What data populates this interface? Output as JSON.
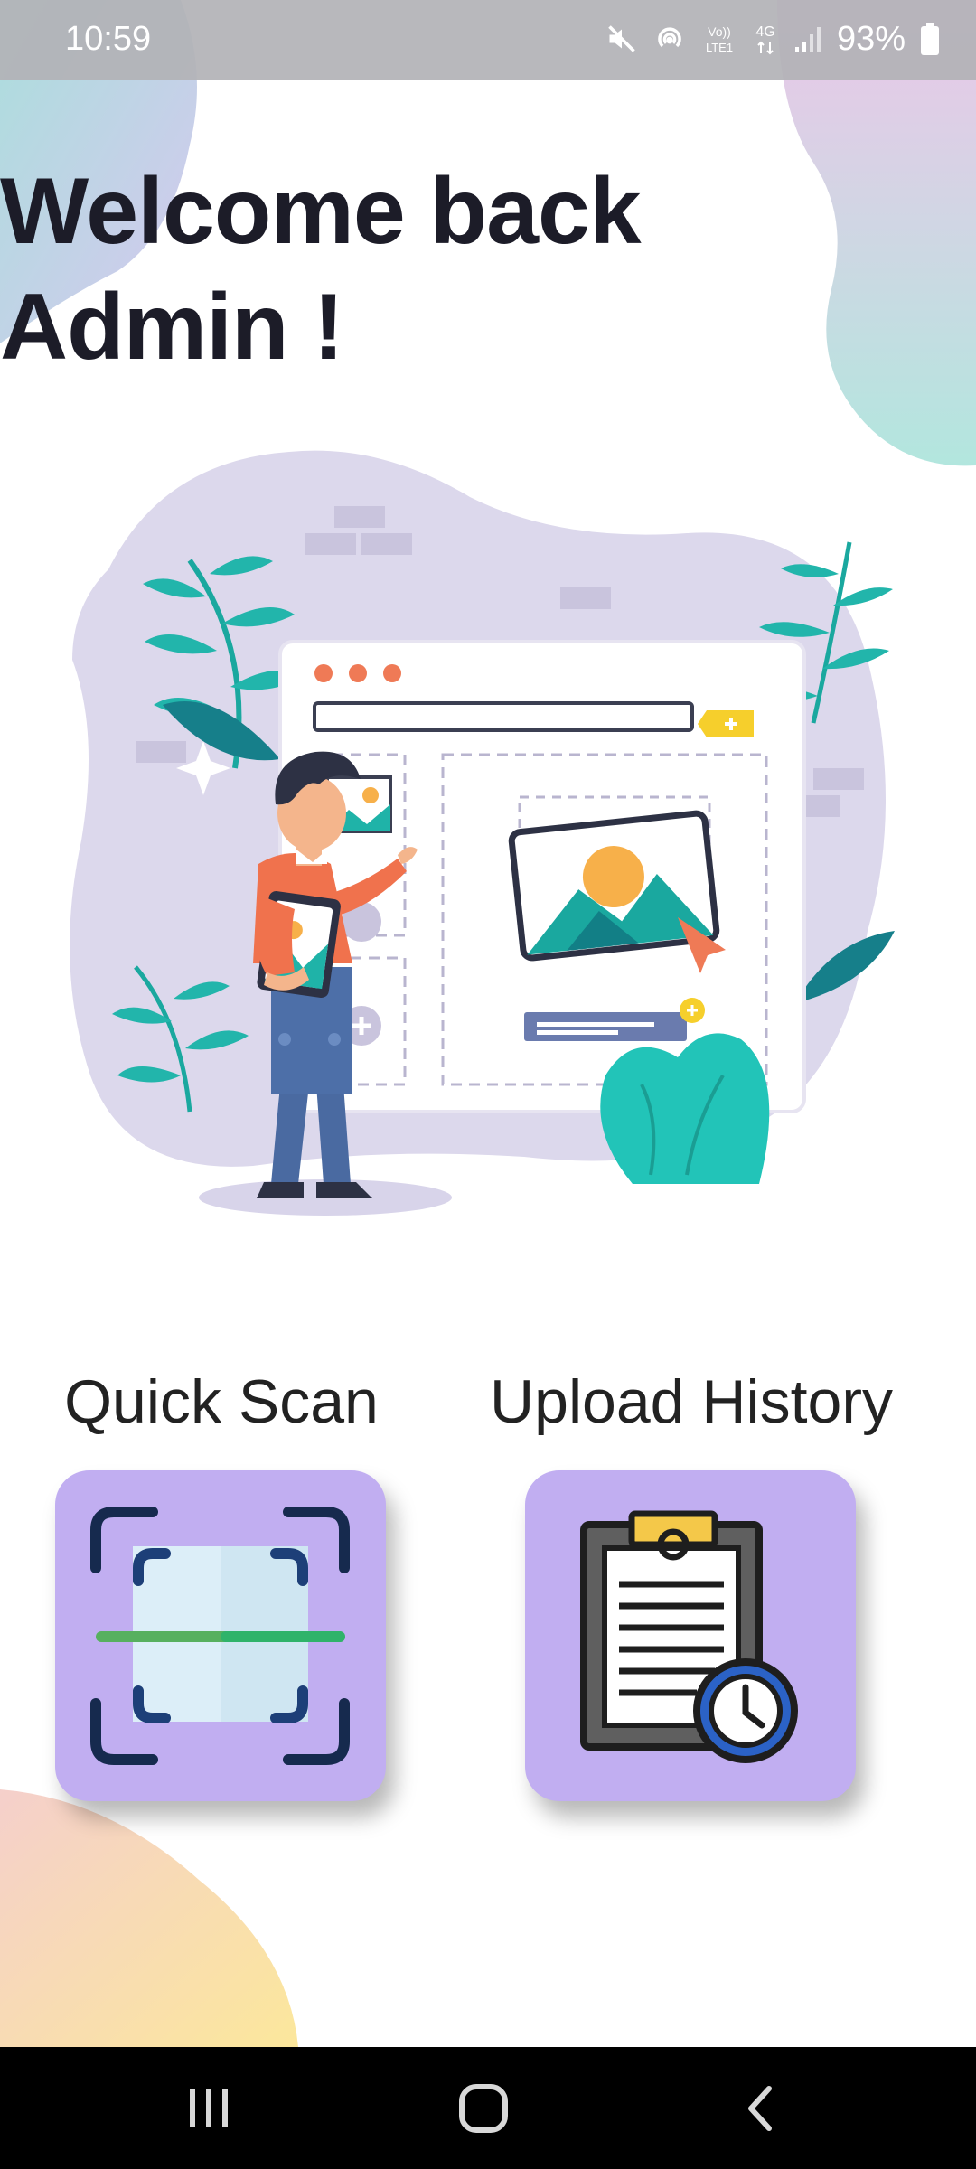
{
  "status_bar": {
    "time": "10:59",
    "battery_text": "93%",
    "icons": [
      "mute-icon",
      "hotspot-icon",
      "volte-icon",
      "4g-data-icon",
      "signal-icon",
      "battery-icon"
    ]
  },
  "welcome": {
    "line1": "Welcome back",
    "line2": "Admin !"
  },
  "hero": {
    "icon": "image-upload-illustration"
  },
  "actions": [
    {
      "label": "Quick Scan",
      "icon": "scan-icon"
    },
    {
      "label": "Upload History",
      "icon": "clipboard-history-icon"
    }
  ],
  "colors": {
    "card_bg": "#c1aef1",
    "accent_teal": "#1fb3a8",
    "title_text": "#1c1c28"
  },
  "nav": {
    "icons": [
      "recent-apps-icon",
      "home-icon",
      "back-icon"
    ]
  }
}
